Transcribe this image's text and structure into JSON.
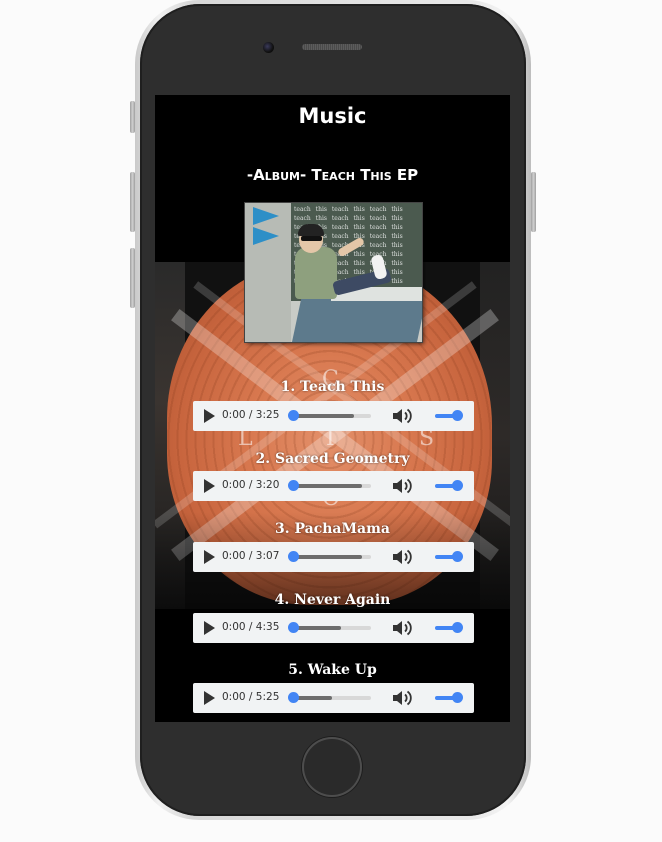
{
  "page": {
    "title": "Music"
  },
  "album": {
    "heading": "-Album- Teach This EP",
    "cover_board_text": "teach this teach this teach this teach this teach this teach this teach this teach this teach this teach this teach this teach this teach this teach this teach this teach this teach this teach this teach this teach this teach this teach this teach this teach this teach this teach this teach this"
  },
  "logo": {
    "letters": [
      "C",
      "L",
      "I",
      "S",
      "O"
    ]
  },
  "tracks": [
    {
      "title": "1. Teach This",
      "time": "0:00 / 3:25",
      "buffered": 0.78
    },
    {
      "title": "2. Sacred Geometry",
      "time": "0:00 / 3:20",
      "buffered": 0.88
    },
    {
      "title": "3. PachaMama",
      "time": "0:00 / 3:07",
      "buffered": 0.88
    },
    {
      "title": "4. Never Again",
      "time": "0:00 / 4:35",
      "buffered": 0.62
    },
    {
      "title": "5. Wake Up",
      "time": "0:00 / 5:25",
      "buffered": 0.5
    }
  ],
  "player": {
    "played": 0,
    "volume": 1.0
  },
  "colors": {
    "accent": "#4285f4",
    "player_bg": "#f1f3f4",
    "screen_bg": "#000000"
  },
  "icons": {
    "play": "play-icon",
    "volume": "volume-icon"
  }
}
